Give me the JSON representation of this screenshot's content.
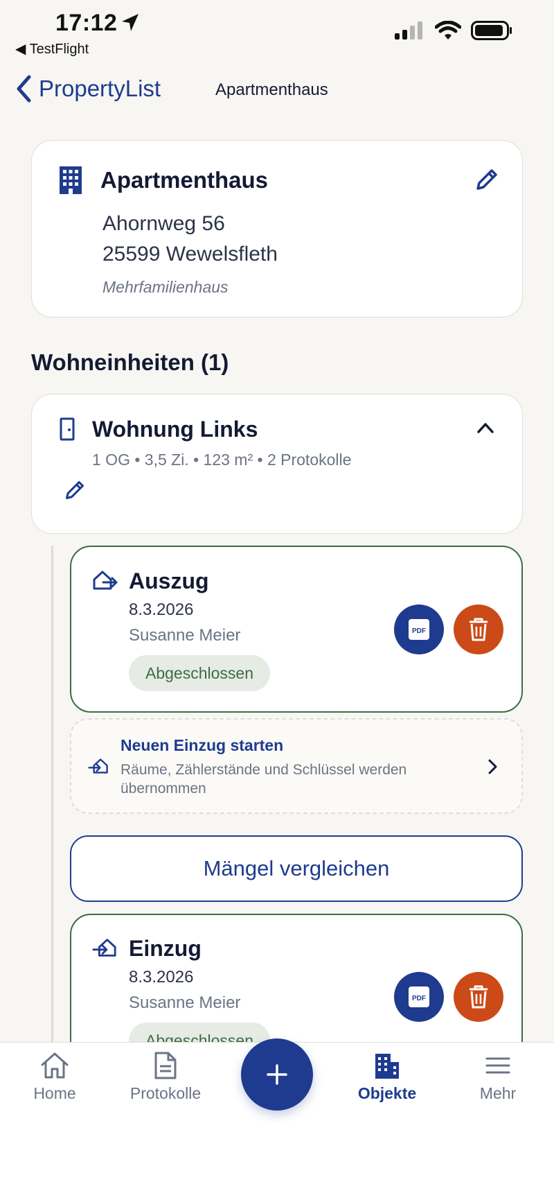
{
  "status_bar": {
    "time": "17:12",
    "back_app": "◀ TestFlight"
  },
  "nav": {
    "back_label": "PropertyList",
    "title": "Apartmenthaus"
  },
  "property": {
    "name": "Apartmenthaus",
    "street": "Ahornweg 56",
    "city": "25599 Wewelsfleth",
    "type": "Mehrfamilienhaus",
    "icon": "building-icon"
  },
  "units_section": {
    "title": "Wohneinheiten (1)"
  },
  "unit": {
    "name": "Wohnung Links",
    "meta": "1 OG • 3,5 Zi. • 123 m² • 2 Protokolle",
    "icon": "door-icon"
  },
  "protocols": [
    {
      "title": "Auszug",
      "date": "8.3.2026",
      "person": "Susanne Meier",
      "status": "Abgeschlossen",
      "icon": "move-out-icon"
    },
    {
      "title": "Einzug",
      "date": "8.3.2026",
      "person": "Susanne Meier",
      "status": "Abgeschlossen",
      "icon": "move-in-icon"
    }
  ],
  "new_move_in": {
    "title": "Neuen Einzug starten",
    "description": "Räume, Zählerstände und Schlüssel werden übernommen"
  },
  "compare_button": "Mängel vergleichen",
  "pdf_label": "PDF",
  "tabs": [
    {
      "label": "Home",
      "icon": "home-icon",
      "active": false
    },
    {
      "label": "Protokolle",
      "icon": "document-icon",
      "active": false
    },
    {
      "label": "Objekte",
      "icon": "buildings-icon",
      "active": true
    },
    {
      "label": "Mehr",
      "icon": "menu-icon",
      "active": false
    }
  ],
  "colors": {
    "primary": "#1f3b8f",
    "danger": "#cc4a17",
    "success": "#3e6b45",
    "background": "#f7f6f2"
  }
}
